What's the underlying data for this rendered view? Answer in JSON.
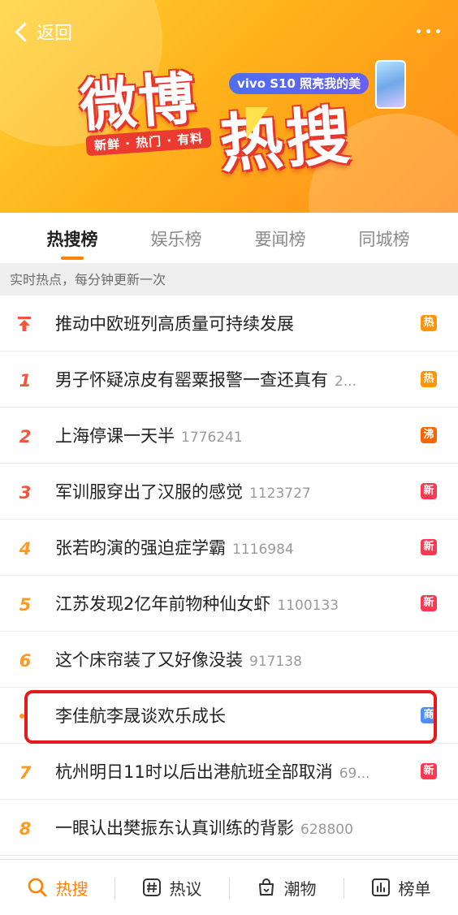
{
  "header": {
    "back_label": "返回",
    "banner_title_1": "微博",
    "banner_title_2": "热搜",
    "slogan": "新鲜 · 热门 · 有料",
    "ad_text": "vivo S10 照亮我的美"
  },
  "tabs": [
    {
      "label": "热搜榜",
      "active": true
    },
    {
      "label": "娱乐榜",
      "active": false
    },
    {
      "label": "要闻榜",
      "active": false
    },
    {
      "label": "同城榜",
      "active": false
    }
  ],
  "subheader": "实时热点，每分钟更新一次",
  "rows": [
    {
      "rank": "",
      "topic": "推动中欧班列高质量可持续发展",
      "count": "",
      "badge": "热"
    },
    {
      "rank": "1",
      "topic": "男子怀疑凉皮有罂粟报警一查还真有",
      "count": "2...",
      "badge": "热"
    },
    {
      "rank": "2",
      "topic": "上海停课一天半",
      "count": "1776241",
      "badge": "沸"
    },
    {
      "rank": "3",
      "topic": "军训服穿出了汉服的感觉",
      "count": "1123727",
      "badge": "新"
    },
    {
      "rank": "4",
      "topic": "张若昀演的强迫症学霸",
      "count": "1116984",
      "badge": "新"
    },
    {
      "rank": "5",
      "topic": "江苏发现2亿年前物种仙女虾",
      "count": "1100133",
      "badge": "新"
    },
    {
      "rank": "6",
      "topic": "这个床帘装了又好像没装",
      "count": "917138",
      "badge": ""
    },
    {
      "rank": "",
      "topic": "李佳航李晟谈欢乐成长",
      "count": "",
      "badge": "商"
    },
    {
      "rank": "7",
      "topic": "杭州明日11时以后出港航班全部取消",
      "count": "69...",
      "badge": "新"
    },
    {
      "rank": "8",
      "topic": "一眼认出樊振东认真训练的背影",
      "count": "628800",
      "badge": ""
    }
  ],
  "bottom_nav": [
    {
      "label": "热搜",
      "icon": "search-icon",
      "active": true
    },
    {
      "label": "热议",
      "icon": "hashtag-icon",
      "active": false
    },
    {
      "label": "潮物",
      "icon": "shopping-bag-icon",
      "active": false
    },
    {
      "label": "榜单",
      "icon": "chart-icon",
      "active": false
    }
  ],
  "colors": {
    "accent": "#ff8200",
    "rank_red": "#f6543b",
    "rank_orange": "#ff9a1f",
    "badge_hot": "#ff9406",
    "badge_boil": "#f86400",
    "badge_new": "#ff3852",
    "badge_biz": "#4f8dff",
    "highlight_box": "#e8191c"
  }
}
